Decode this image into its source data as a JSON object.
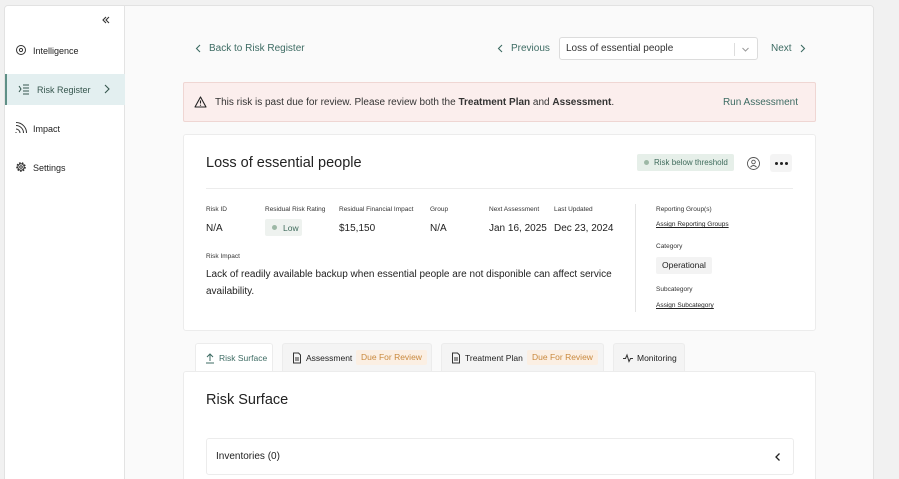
{
  "sidebar": {
    "items": [
      {
        "label": "Intelligence",
        "icon": "eye-icon"
      },
      {
        "label": "Risk Register",
        "icon": "risk-register-icon",
        "active": true
      },
      {
        "label": "Impact",
        "icon": "signal-icon"
      },
      {
        "label": "Settings",
        "icon": "gear-icon"
      }
    ]
  },
  "topbar": {
    "back_label": "Back to Risk Register",
    "previous_label": "Previous",
    "selected_risk": "Loss of essential people",
    "next_label": "Next"
  },
  "alert": {
    "text_1": "This risk is past due for review. Please review both the ",
    "bold_1": "Treatment Plan",
    "text_2": " and ",
    "bold_2": "Assessment",
    "text_3": ".",
    "action_label": "Run Assessment"
  },
  "risk": {
    "title": "Loss of essential people",
    "threshold_badge": "Risk below threshold",
    "fields": {
      "risk_id_label": "Risk ID",
      "risk_id": "N/A",
      "residual_rating_label": "Residual Risk Rating",
      "residual_rating": "Low",
      "residual_financial_label": "Residual Financial Impact",
      "residual_financial": "$15,150",
      "group_label": "Group",
      "group": "N/A",
      "next_assessment_label": "Next Assessment",
      "next_assessment": "Jan 16, 2025",
      "last_updated_label": "Last Updated",
      "last_updated": "Dec 23, 2024"
    },
    "impact_label": "Risk Impact",
    "impact_text": "Lack of readily available backup when essential people are not disponible can affect service availability.",
    "side": {
      "reporting_groups_label": "Reporting Group(s)",
      "reporting_groups_link": "Assign Reporting Groups",
      "category_label": "Category",
      "category": "Operational",
      "subcategory_label": "Subcategory",
      "subcategory_link": "Assign Subcategory"
    }
  },
  "tabs": [
    {
      "label": "Risk Surface",
      "icon": "upload-icon",
      "active": true
    },
    {
      "label": "Assessment",
      "icon": "document-icon",
      "badge": "Due For Review"
    },
    {
      "label": "Treatment Plan",
      "icon": "document-icon",
      "badge": "Due For Review"
    },
    {
      "label": "Monitoring",
      "icon": "pulse-icon"
    }
  ],
  "surface": {
    "title": "Risk Surface",
    "inventories_label": "Inventories (0)"
  },
  "colors": {
    "accent": "#3d6b63",
    "warning_bg": "#fbeeed",
    "due_badge": "#c9893d"
  }
}
